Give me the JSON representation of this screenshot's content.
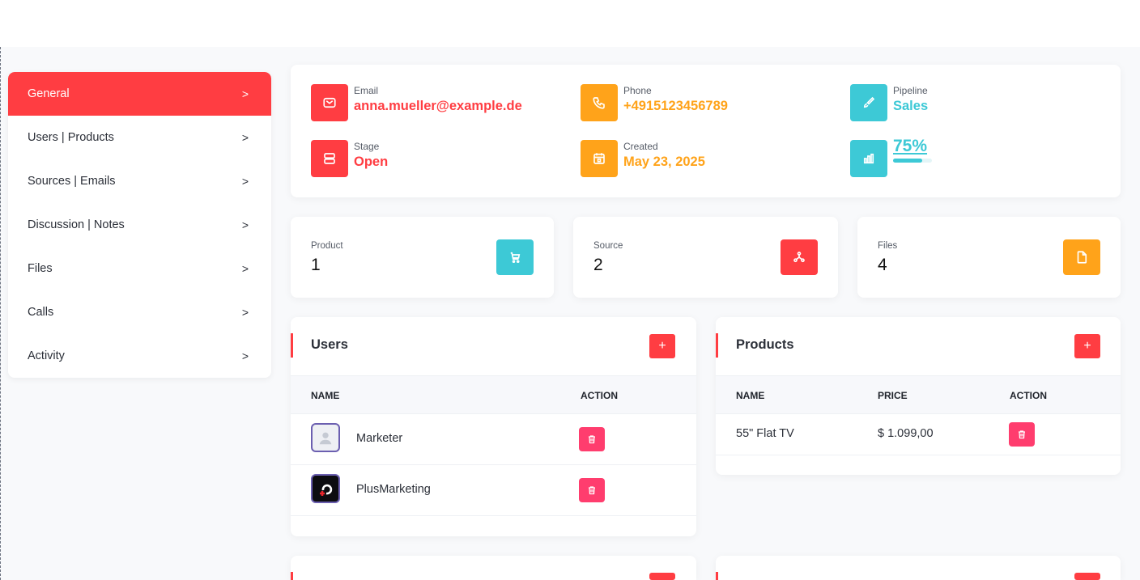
{
  "sidebar": {
    "items": [
      {
        "label": "General",
        "active": true
      },
      {
        "label": "Users | Products"
      },
      {
        "label": "Sources | Emails"
      },
      {
        "label": "Discussion | Notes"
      },
      {
        "label": "Files"
      },
      {
        "label": "Calls"
      },
      {
        "label": "Activity"
      }
    ],
    "chevron": ">"
  },
  "info": {
    "email": {
      "label": "Email",
      "value": "anna.mueller@example.de",
      "icon": "mail-icon"
    },
    "phone": {
      "label": "Phone",
      "value": "+4915123456789",
      "icon": "phone-icon"
    },
    "pipeline": {
      "label": "Pipeline",
      "value": "Sales",
      "icon": "brush-icon"
    },
    "stage": {
      "label": "Stage",
      "value": "Open",
      "icon": "server-icon"
    },
    "created": {
      "label": "Created",
      "value": "May 23, 2025",
      "icon": "calendar-icon"
    },
    "progress": {
      "label": "75%",
      "value": 0.75,
      "icon": "chart-bars-icon"
    }
  },
  "stats": [
    {
      "label": "Product",
      "value": "1",
      "icon": "cart-icon"
    },
    {
      "label": "Source",
      "value": "2",
      "icon": "share-nodes-icon"
    },
    {
      "label": "Files",
      "value": "4",
      "icon": "file-icon"
    }
  ],
  "users_panel": {
    "title": "Users",
    "add_label": "+",
    "columns": [
      "NAME",
      "ACTION"
    ],
    "rows": [
      {
        "name": "Marketer",
        "avatar": "person-placeholder-icon"
      },
      {
        "name": "PlusMarketing",
        "avatar": "plusmarketing-logo"
      }
    ]
  },
  "products_panel": {
    "title": "Products",
    "add_label": "+",
    "columns": [
      "NAME",
      "PRICE",
      "ACTION"
    ],
    "rows": [
      {
        "name": "55\" Flat TV",
        "price": "$ 1.099,00"
      }
    ]
  },
  "colors": {
    "red": "#ff3d42",
    "orange": "#ffa31a",
    "teal": "#3dc9d6",
    "pink": "#ff3d6e"
  }
}
